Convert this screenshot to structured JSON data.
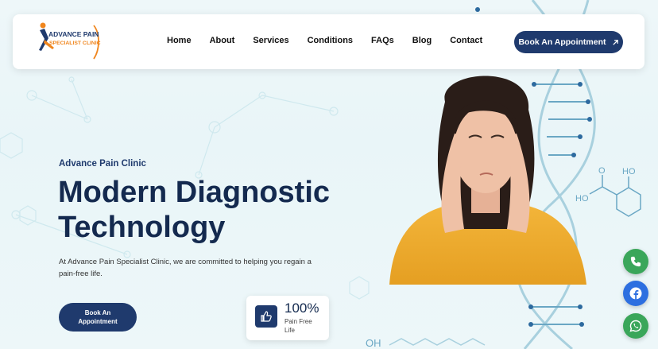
{
  "logo": {
    "line1": "ADVANCE PAIN",
    "line2": "SPECIALIST CLINIC"
  },
  "nav": [
    {
      "label": "Home"
    },
    {
      "label": "About"
    },
    {
      "label": "Services"
    },
    {
      "label": "Conditions"
    },
    {
      "label": "FAQs"
    },
    {
      "label": "Blog"
    },
    {
      "label": "Contact"
    }
  ],
  "header_cta": {
    "label": "Book An Appointment",
    "icon": "arrow-up-right-icon"
  },
  "hero": {
    "eyebrow": "Advance Pain Clinic",
    "title_line1": "Modern Diagnostic",
    "title_line2": "Technology",
    "description": "At Advance Pain Specialist Clinic, we are committed to helping you regain a pain-free life.",
    "cta_line1": "Book An",
    "cta_line2": "Appointment"
  },
  "stat": {
    "value": "100%",
    "label_line1": "Pain Free",
    "label_line2": "Life",
    "icon": "thumbs-up-icon"
  },
  "molecule_labels": {
    "o": "O",
    "ho_top": "HO",
    "ho_left": "HO",
    "bottom": "OH"
  },
  "floating": [
    {
      "name": "phone-button",
      "icon": "phone-icon",
      "color": "#3aa65a"
    },
    {
      "name": "facebook-button",
      "icon": "facebook-icon",
      "color": "#2d6fe0"
    },
    {
      "name": "whatsapp-button",
      "icon": "whatsapp-icon",
      "color": "#3aa65a"
    }
  ],
  "colors": {
    "primary": "#1f3a6d",
    "title": "#142a4f",
    "accent_orange": "#f0861e"
  }
}
